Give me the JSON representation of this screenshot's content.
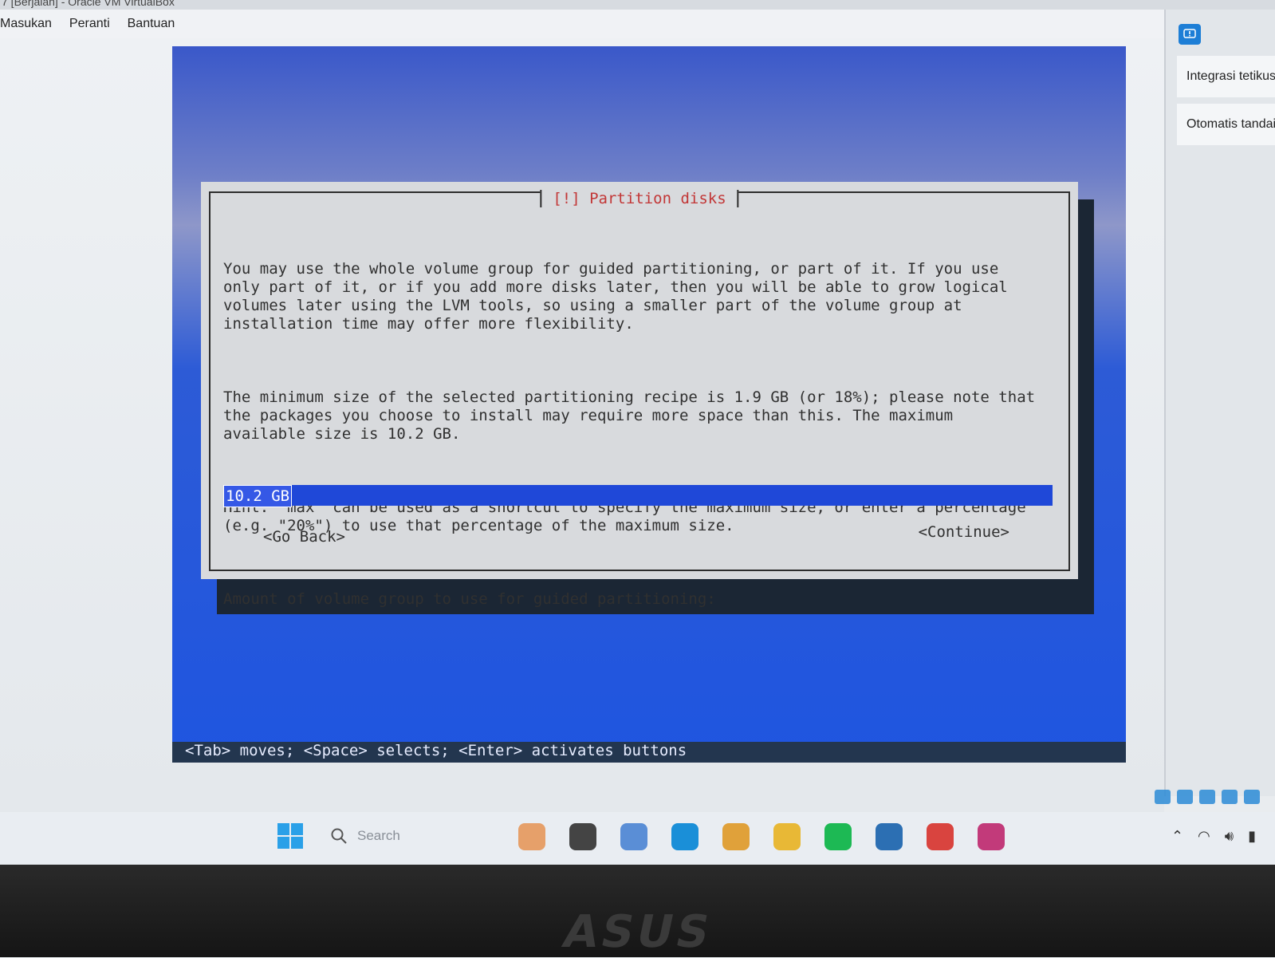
{
  "window": {
    "title": "7 [Berjalan] - Oracle VM VirtualBox"
  },
  "menubar": {
    "items": [
      "Masukan",
      "Peranti",
      "Bantuan"
    ]
  },
  "sidebar": {
    "items": [
      "Integrasi tetikus",
      "Otomatis tandai"
    ]
  },
  "installer": {
    "dialog_title": "[!] Partition disks",
    "paragraphs": [
      "You may use the whole volume group for guided partitioning, or part of it. If you use\nonly part of it, or if you add more disks later, then you will be able to grow logical\nvolumes later using the LVM tools, so using a smaller part of the volume group at\ninstallation time may offer more flexibility.",
      "The minimum size of the selected partitioning recipe is 1.9 GB (or 18%); please note that\nthe packages you choose to install may require more space than this. The maximum\navailable size is 10.2 GB.",
      "Hint: \"max\" can be used as a shortcut to specify the maximum size, or enter a percentage\n(e.g. \"20%\") to use that percentage of the maximum size.",
      "Amount of volume group to use for guided partitioning:"
    ],
    "input_value": "10.2 GB",
    "go_back_label": "<Go Back>",
    "continue_label": "<Continue>",
    "hint_line": "<Tab> moves; <Space> selects; <Enter> activates buttons"
  },
  "taskbar": {
    "search_placeholder": "Search",
    "apps": [
      "widgets-icon",
      "terminal-icon",
      "file-explorer-icon",
      "edge-icon",
      "chrome-icon",
      "folder-icon",
      "spotify-icon",
      "virtualbox-icon",
      "chrome-profile-icon",
      "app-icon"
    ],
    "app_colors": [
      "#e6a06a",
      "#444444",
      "#5a8ed6",
      "#1a8fd8",
      "#e0a13a",
      "#e8b836",
      "#1db954",
      "#2c6fb3",
      "#d9443f",
      "#c23a7a"
    ]
  },
  "bezel": {
    "brand": "ASUS"
  }
}
